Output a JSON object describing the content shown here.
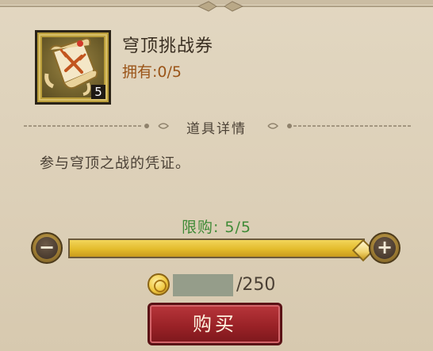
{
  "item": {
    "name": "穹顶挑战券",
    "owned_text": "拥有:0/5",
    "quantity": "5",
    "icon": "scroll-ticket-icon"
  },
  "section": {
    "title": "道具详情"
  },
  "description": "参与穹顶之战的凭证。",
  "purchase": {
    "limit_text": "限购: 5/5",
    "slider_fraction": 1.0,
    "minus_label": "−",
    "plus_label": "+",
    "balance_text": "",
    "cost_text": "/250",
    "buy_label": "购买"
  },
  "colors": {
    "accent_gold": "#e3bb2c",
    "buy_red": "#9a2227",
    "limit_green": "#3f8a36",
    "owned_orange": "#9a5418"
  }
}
